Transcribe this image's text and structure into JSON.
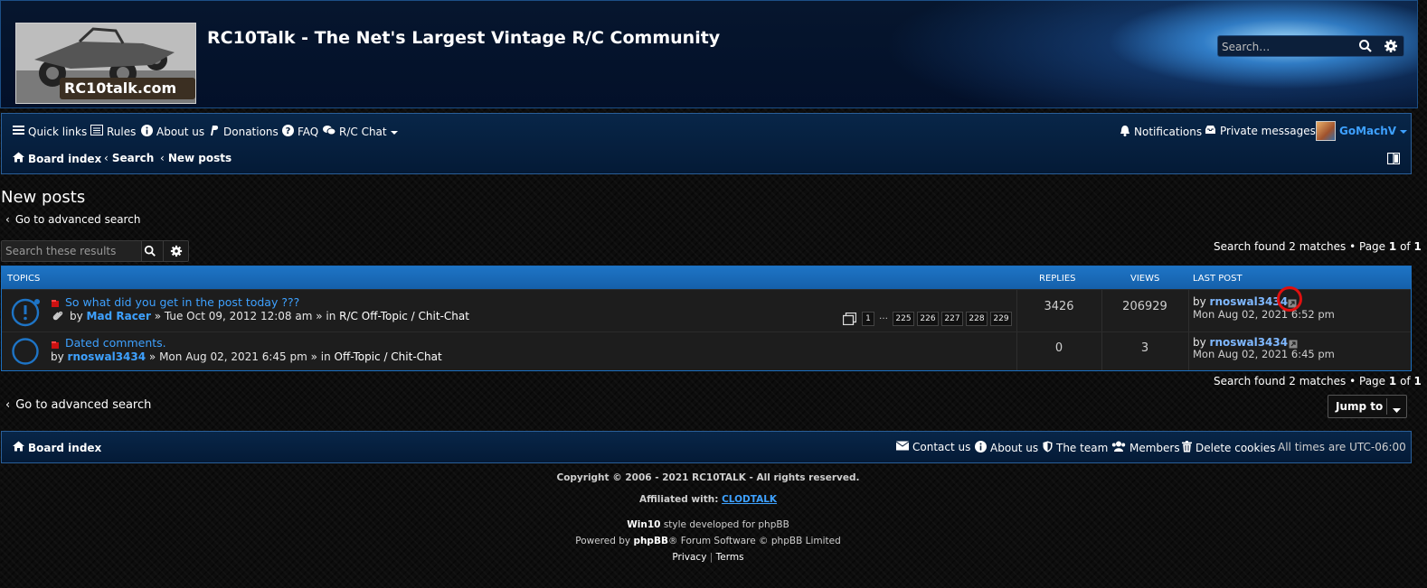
{
  "header": {
    "site_title": "RC10Talk - The Net's Largest Vintage R/C Community",
    "logo_text": "RC10talk.com",
    "search_placeholder": "Search…"
  },
  "navbar": {
    "quick_links": "Quick links",
    "rules": "Rules",
    "about_us": "About us",
    "donations": "Donations",
    "faq": "FAQ",
    "rc_chat": "R/C Chat",
    "notifications": "Notifications",
    "private_messages": "Private messages",
    "username": "GoMachV",
    "breadcrumb": [
      "Board index",
      "Search",
      "New posts"
    ]
  },
  "page": {
    "title": "New posts",
    "advanced_search_link": "Go to advanced search",
    "results_search_placeholder": "Search these results",
    "results_summary": "Search found 2 matches • Page",
    "page_current": "1",
    "page_of": "of",
    "page_total": "1"
  },
  "topics_table": {
    "headers": {
      "topics": "TOPICS",
      "replies": "REPLIES",
      "views": "VIEWS",
      "last_post": "LAST POST"
    },
    "rows": [
      {
        "title": "So what did you get in the post today ???",
        "by_label": "by",
        "author": "Mad Racer",
        "date": "» Tue Oct 09, 2012 12:08 am » in",
        "forum": "R/C Off-Topic / Chit-Chat",
        "pages": [
          "1",
          "…",
          "225",
          "226",
          "227",
          "228",
          "229"
        ],
        "replies": "3426",
        "views": "206929",
        "last_by": "by",
        "last_user": "rnoswal3434",
        "last_date": "Mon Aug 02, 2021 6:52 pm",
        "has_attachment": true
      },
      {
        "title": "Dated comments.",
        "by_label": "by",
        "author": "rnoswal3434",
        "date": "» Mon Aug 02, 2021 6:45 pm » in",
        "forum": "Off-Topic / Chit-Chat",
        "replies": "0",
        "views": "3",
        "last_by": "by",
        "last_user": "rnoswal3434",
        "last_date": "Mon Aug 02, 2021 6:45 pm"
      }
    ]
  },
  "jump_to": "Jump to",
  "footer": {
    "board_index": "Board index",
    "contact_us": "Contact us",
    "about_us": "About us",
    "the_team": "The team",
    "members": "Members",
    "delete_cookies": "Delete cookies",
    "timezone": "All times are UTC-06:00",
    "copyright": "Copyright © 2006 - 2021 RC10TALK - All rights reserved.",
    "affiliated_label": "Affiliated with:",
    "affiliated_link": "CLODTALK",
    "style_name": "Win10",
    "style_text": "style developed for phpBB",
    "powered_by": "Powered by",
    "phpbb": "phpBB",
    "powered_rest": "® Forum Software © phpBB Limited",
    "privacy": "Privacy",
    "terms": "Terms"
  },
  "colors": {
    "accent_blue": "#1e74c5",
    "link_blue": "#3ea1ff",
    "unread_red": "#cc1111"
  }
}
